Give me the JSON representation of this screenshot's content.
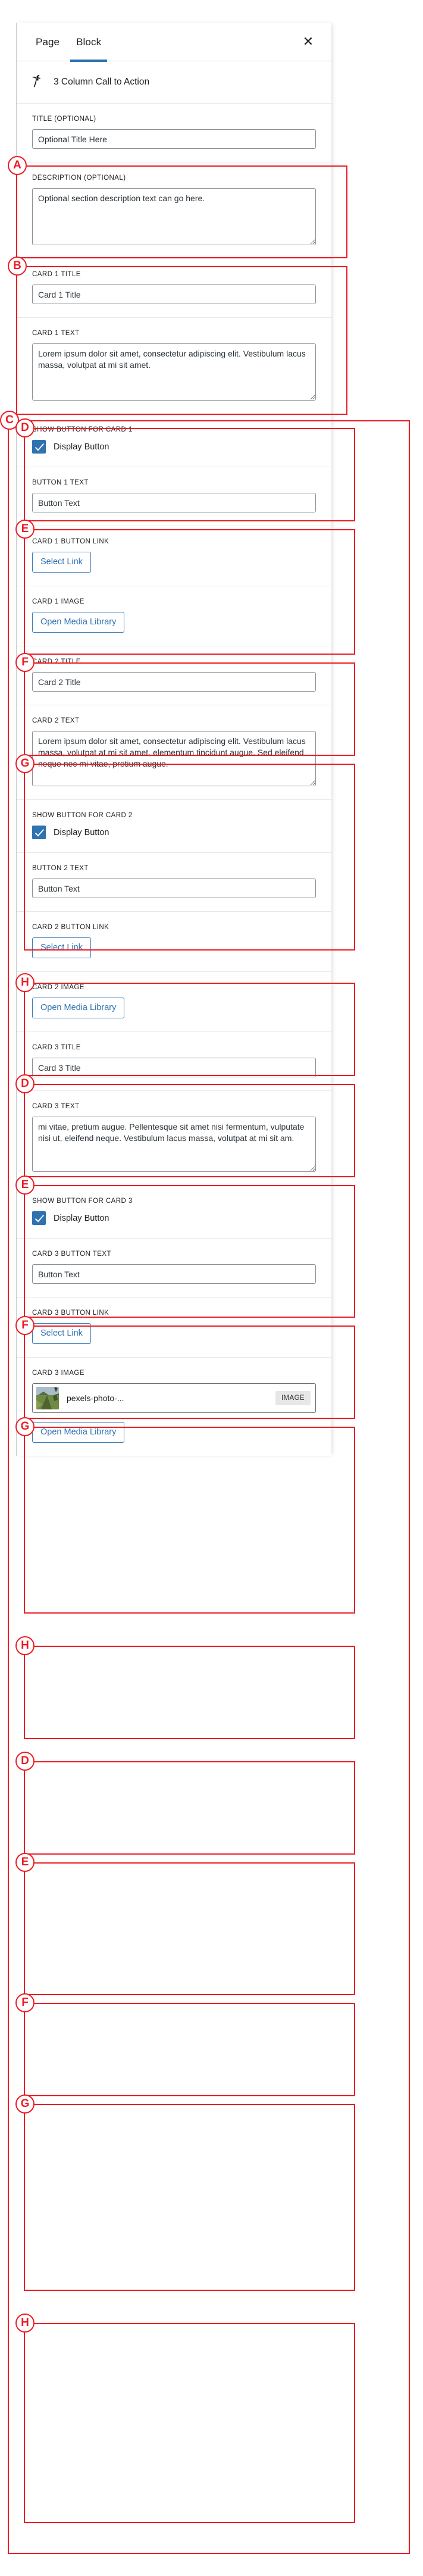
{
  "window": {
    "tabs": [
      {
        "label": "Page",
        "active": false
      },
      {
        "label": "Block",
        "active": true
      }
    ],
    "close_icon": "close-icon",
    "close_glyph": "✕",
    "accent_color": "#2e72b0",
    "annotation_color": "#ed1c24"
  },
  "block_header": {
    "icon": "palm-tree-icon",
    "title": "3 Column Call to Action"
  },
  "sections": {
    "title": {
      "label": "TITLE (OPTIONAL)",
      "value": "Optional Title Here",
      "annotation": "A"
    },
    "description": {
      "label": "DESCRIPTION (OPTIONAL)",
      "value": "Optional section description text can go here.",
      "annotation": "B"
    },
    "cards_group_annotation": "C"
  },
  "cards": [
    {
      "annotations": {
        "title": "D",
        "text": "E",
        "show_button": "F",
        "button": "G",
        "image": "H"
      },
      "title_label": "CARD 1 TITLE",
      "title_value": "Card 1 Title",
      "text_label": "CARD 1 TEXT",
      "text_value": "Lorem ipsum dolor sit amet, consectetur adipiscing elit. Vestibulum lacus massa, volutpat at mi sit amet.",
      "show_button_label": "SHOW BUTTON FOR CARD 1",
      "checkbox_label": "Display Button",
      "checkbox_checked": true,
      "button_text_label": "BUTTON 1 TEXT",
      "button_text_value": "Button Text",
      "button_link_label": "CARD 1 BUTTON LINK",
      "select_link_label": "Select Link",
      "image_label": "CARD 1 IMAGE",
      "open_media_label": "Open Media Library",
      "has_attachment": false,
      "scrolled": false
    },
    {
      "annotations": {
        "title": "D",
        "text": "E",
        "show_button": "F",
        "button": "G",
        "image": "H"
      },
      "title_label": "CARD 2 TITLE",
      "title_value": "Card 2 Title",
      "text_label": "CARD 2 TEXT",
      "text_value": "Lorem ipsum dolor sit amet, consectetur adipiscing elit. Vestibulum lacus massa, volutpat at mi sit amet, elementum tincidunt augue. Sed eleifend neque nec mi vitae, pretium augue.",
      "show_button_label": "SHOW BUTTON FOR CARD 2",
      "checkbox_label": "Display Button",
      "checkbox_checked": true,
      "button_text_label": "BUTTON 2 TEXT",
      "button_text_value": "Button Text",
      "button_link_label": "CARD 2 BUTTON LINK",
      "select_link_label": "Select Link",
      "image_label": "CARD 2 IMAGE",
      "open_media_label": "Open Media Library",
      "has_attachment": false,
      "scrolled": false
    },
    {
      "annotations": {
        "title": "D",
        "text": "E",
        "show_button": "F",
        "button": "G",
        "image": "H"
      },
      "title_label": "CARD 3 TITLE",
      "title_value": "Card 3 Title",
      "text_label": "CARD 3 TEXT",
      "text_value": "mi vitae, pretium augue. Pellentesque sit amet nisi fermentum, vulputate nisi ut, eleifend neque. Vestibulum lacus massa, volutpat at mi sit am.",
      "show_button_label": "SHOW BUTTON FOR CARD 3",
      "checkbox_label": "Display Button",
      "checkbox_checked": true,
      "button_text_label": "CARD 3 BUTTON TEXT",
      "button_text_value": "Button Text",
      "button_link_label": "CARD 3 BUTTON LINK",
      "select_link_label": "Select Link",
      "image_label": "CARD 3 IMAGE",
      "open_media_label": "Open Media Library",
      "has_attachment": true,
      "attachment_name": "pexels-photo-...",
      "attachment_kind": "IMAGE",
      "scrolled": true
    }
  ]
}
